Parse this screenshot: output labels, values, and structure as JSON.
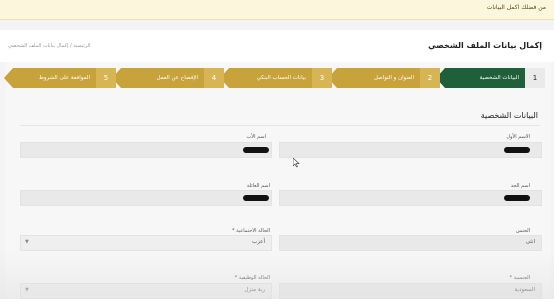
{
  "notice": {
    "text": "من فضلك اكمل البيانات"
  },
  "header": {
    "title": "إكمال بيانات الملف الشخصي",
    "breadcrumb": "الرئيسية / إكمال بيانات الملف الشخصي"
  },
  "stepper": {
    "steps": [
      {
        "number": "1",
        "label": "البيانات الشخصية",
        "state": "active"
      },
      {
        "number": "2",
        "label": "العنوان و التواصل",
        "state": "todo"
      },
      {
        "number": "3",
        "label": "بيانات الحساب البنكي",
        "state": "todo"
      },
      {
        "number": "4",
        "label": "الإفصاح عن العمل",
        "state": "todo"
      },
      {
        "number": "5",
        "label": "الموافقة على الشروط",
        "state": "todo"
      }
    ]
  },
  "form": {
    "section_title": "البيانات الشخصية",
    "first_name": {
      "label": "الاسم الأول",
      "value": ""
    },
    "father_name": {
      "label": "اسم الأب",
      "value": ""
    },
    "grandfather_name": {
      "label": "اسم الجد",
      "value": ""
    },
    "family_name": {
      "label": "اسم العائلة",
      "value": ""
    },
    "gender": {
      "label": "الجنس",
      "value": "انثى"
    },
    "marital_status": {
      "label": "الحالة الاجتماعية *",
      "value": "أعزب"
    },
    "nationality": {
      "label": "الجنسية *",
      "value": "السعودية"
    },
    "employment_status": {
      "label": "الحالة الوظيفية *",
      "value": "ربة منزل"
    }
  },
  "colors": {
    "step_active": "#1f5f3a",
    "step_todo": "#c8a23a",
    "notice_bg": "#fbf6dc"
  }
}
